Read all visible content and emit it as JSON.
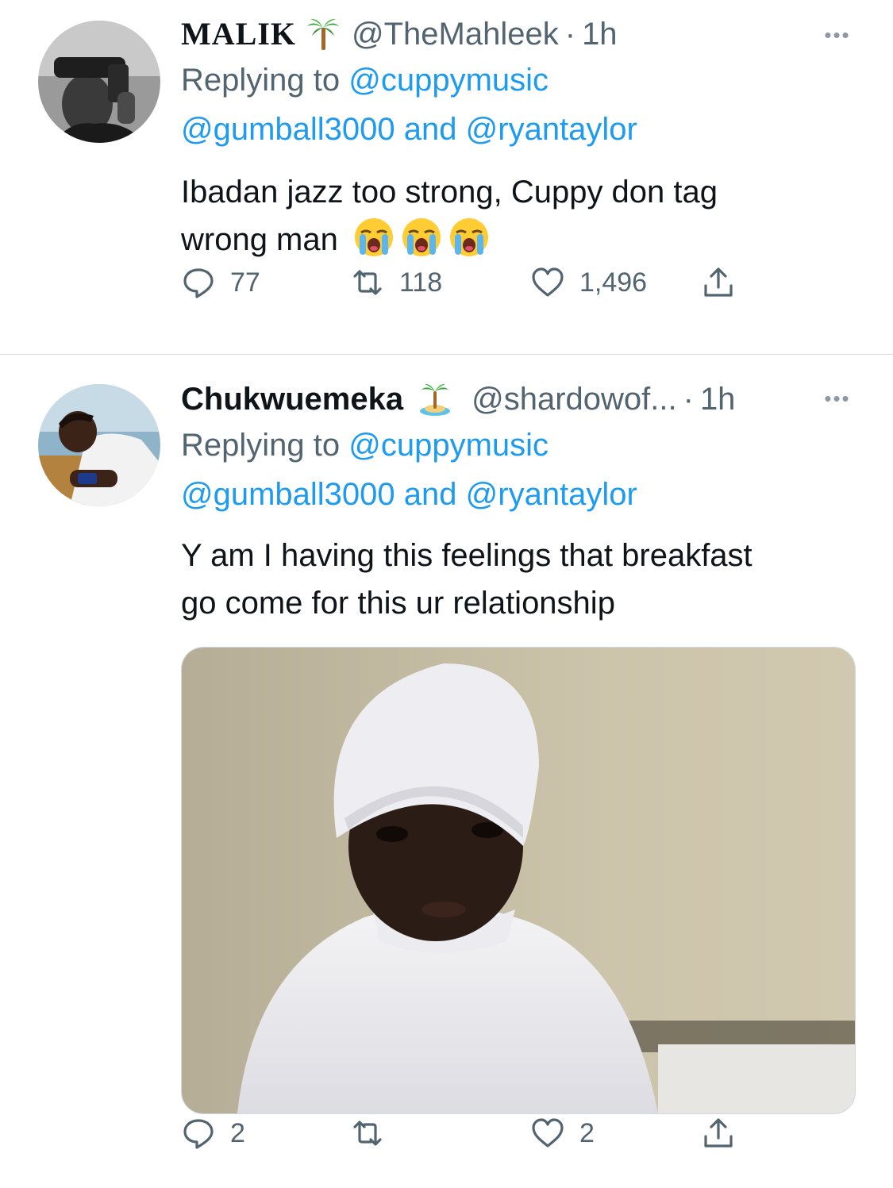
{
  "tweets": [
    {
      "name": "MALIK",
      "name_emoji": "palm-tree-icon",
      "handle": "@TheMahleek",
      "separator": "·",
      "time": "1h",
      "replying_prefix": "Replying to ",
      "replying_to": "@cuppymusic",
      "also_replying": "@gumball3000",
      "and_text": " and ",
      "also_replying_2": "@ryantaylor",
      "text": "Ibadan jazz too strong, Cuppy don tag\nwrong man ",
      "text_emojis": [
        "loudly-crying-face-icon",
        "loudly-crying-face-icon",
        "loudly-crying-face-icon"
      ],
      "actions": {
        "replies": "77",
        "retweets": "118",
        "likes": "1,496"
      }
    },
    {
      "name": "Chukwuemeka",
      "name_emoji": "desert-island-icon",
      "handle": "@shardowof...",
      "separator": "·",
      "time": "1h",
      "replying_prefix": "Replying to ",
      "replying_to": "@cuppymusic",
      "also_replying": "@gumball3000",
      "and_text": " and ",
      "also_replying_2": "@ryantaylor",
      "text": "Y am I having this feelings that breakfast\ngo come for this ur relationship",
      "media": "image-of-boy-in-white-cap",
      "actions": {
        "replies": "2",
        "retweets": "",
        "likes": "2"
      }
    }
  ],
  "more_label": "•••",
  "colors": {
    "link": "#1d9bf0",
    "secondary": "#536471",
    "primary": "#0f1419"
  }
}
